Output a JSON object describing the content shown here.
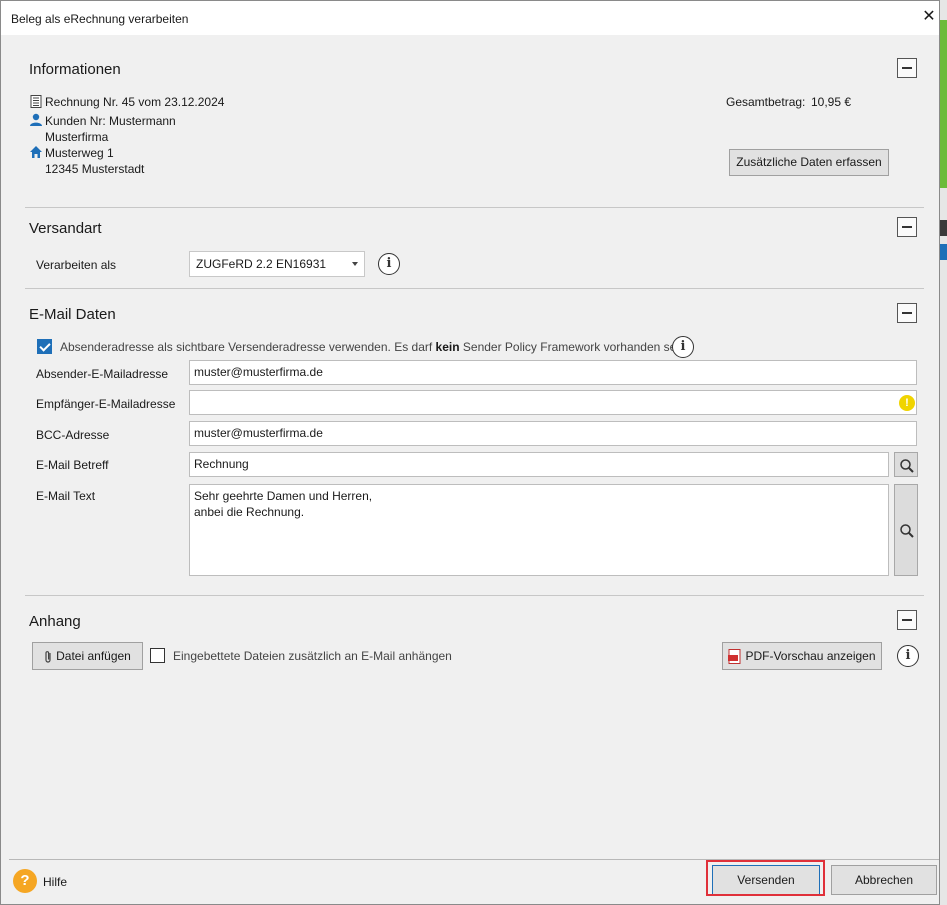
{
  "window": {
    "title": "Beleg als eRechnung verarbeiten",
    "close_glyph": "✕"
  },
  "informationen": {
    "title": "Informationen",
    "invoice": "Rechnung Nr. 45 vom 23.12.2024",
    "customer": "Kunden Nr: Mustermann",
    "company": "Musterfirma",
    "street": "Musterweg 1",
    "city": "12345 Musterstadt",
    "total_label": "Gesamtbetrag:",
    "total_value": "10,95 €",
    "extra_data_button": "Zusätzliche Daten erfassen"
  },
  "versandart": {
    "title": "Versandart",
    "process_label": "Verarbeiten als",
    "process_value": "ZUGFeRD 2.2 EN16931"
  },
  "email": {
    "title": "E-Mail Daten",
    "sender_checkbox_text_a": "Absenderadresse als sichtbare Versenderadresse verwenden. Es darf ",
    "sender_checkbox_text_bold": "kein",
    "sender_checkbox_text_b": " Sender Policy Framework vorhanden sein.",
    "sender_checkbox_checked": true,
    "sender_label": "Absender-E-Mailadresse",
    "sender_value": "muster@musterfirma.de",
    "recipient_label": "Empfänger-E-Mailadresse",
    "recipient_value": "",
    "bcc_label": "BCC-Adresse",
    "bcc_value": "muster@musterfirma.de",
    "subject_label": "E-Mail Betreff",
    "subject_value": "Rechnung",
    "body_label": "E-Mail Text",
    "body_value": "Sehr geehrte Damen und Herren,\nanbei die Rechnung."
  },
  "anhang": {
    "title": "Anhang",
    "attach_button": "Datei anfügen",
    "embedded_checkbox": "Eingebettete Dateien zusätzlich an E-Mail anhängen",
    "embedded_checked": false,
    "pdf_preview_button": "PDF-Vorschau anzeigen"
  },
  "footer": {
    "help_label": "Hilfe",
    "send_button": "Versenden",
    "cancel_button": "Abbrechen"
  },
  "colors": {
    "accent": "#1e6fb8",
    "warning": "#f0d400",
    "help": "#f5a623",
    "highlight": "#e0303a"
  }
}
